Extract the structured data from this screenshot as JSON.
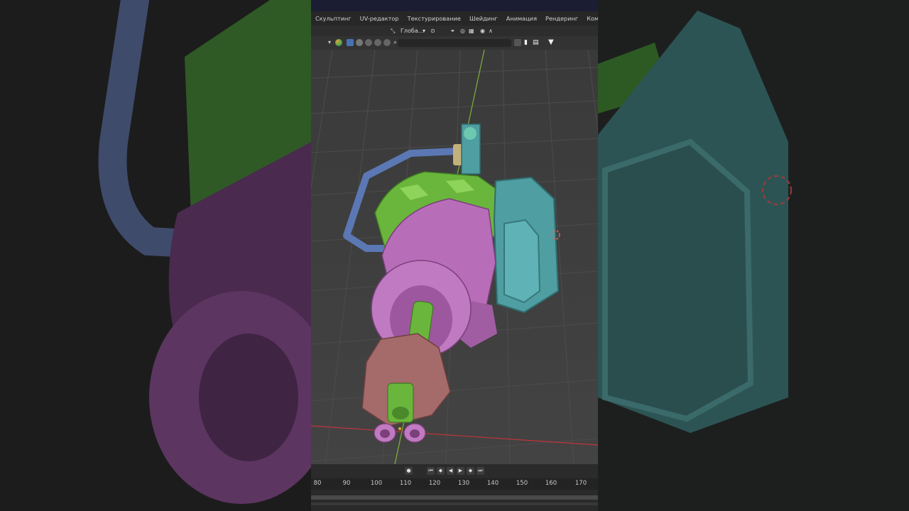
{
  "workspace_tabs": [
    "Скульптинг",
    "UV-редактор",
    "Текстурирование",
    "Шейдинг",
    "Анимация",
    "Рендеринг",
    "Композитинг"
  ],
  "header": {
    "transform_orientation": "Глоба…"
  },
  "timeline": {
    "ruler_ticks": [
      "80",
      "90",
      "100",
      "110",
      "120",
      "130",
      "140",
      "150",
      "160",
      "170"
    ]
  },
  "colors": {
    "accent": "#4772b3",
    "x_axis": "#c0343c",
    "y_axis": "#7fb23a",
    "barrel_pink": "#b86db9",
    "armor_green": "#6ab63c",
    "shield_teal": "#4f9ea1",
    "handle_blue": "#5b78b4",
    "muzzle_rose": "#a56a6a"
  }
}
